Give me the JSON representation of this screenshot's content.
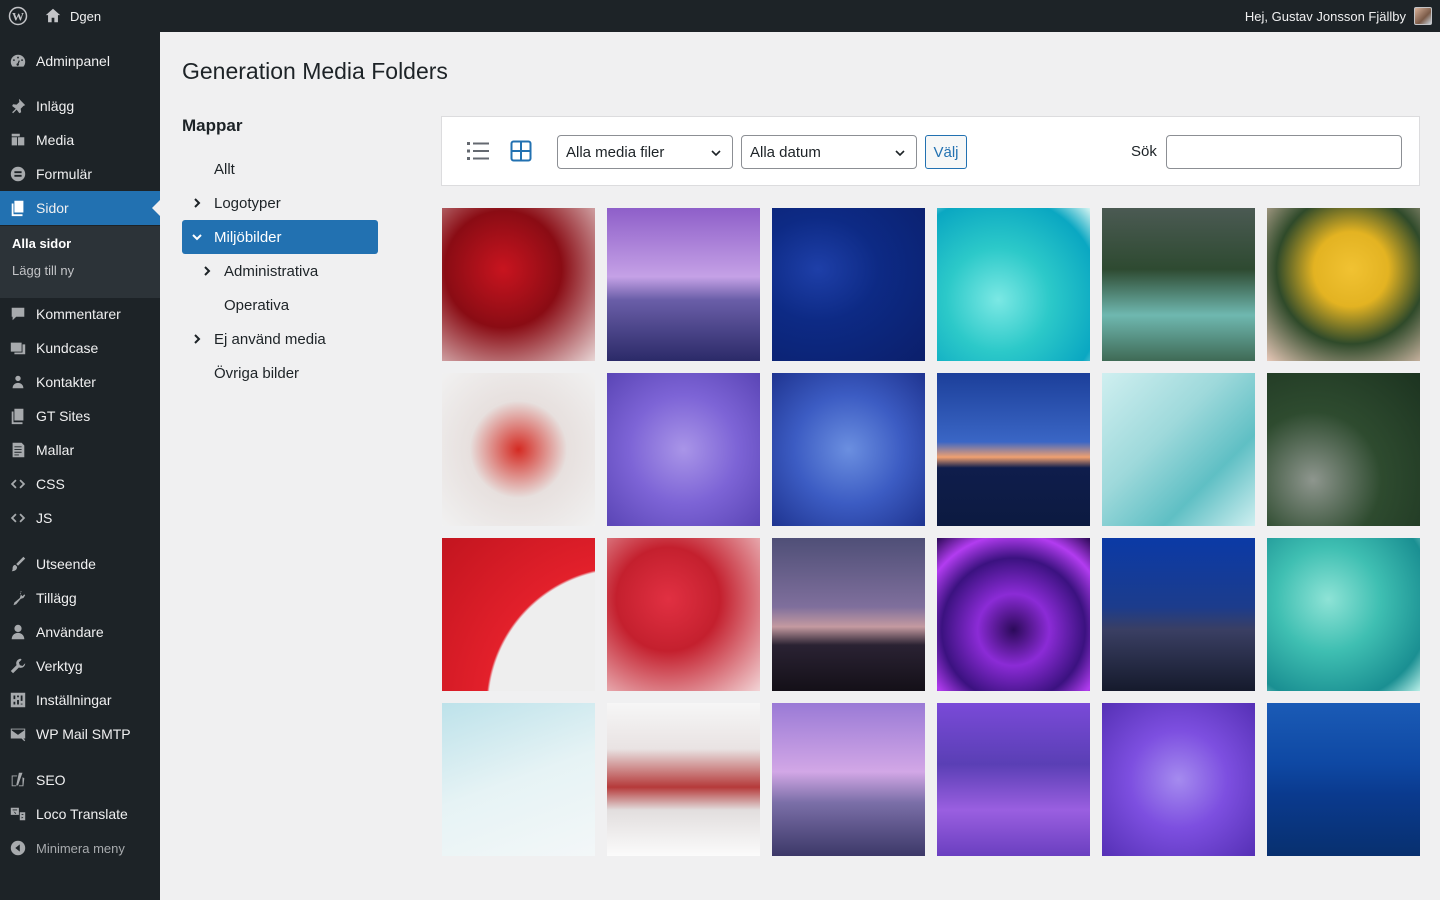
{
  "adminbar": {
    "site_name": "Dgen",
    "greeting": "Hej, Gustav Jonsson Fjällby"
  },
  "sidebar": {
    "items": [
      {
        "label": "Adminpanel",
        "icon": "dashboard-icon"
      },
      {
        "label": "Inlägg",
        "icon": "pin-icon"
      },
      {
        "label": "Media",
        "icon": "media-icon"
      },
      {
        "label": "Formulär",
        "icon": "form-icon"
      },
      {
        "label": "Sidor",
        "icon": "pages-icon"
      },
      {
        "label": "Kommentarer",
        "icon": "comment-icon"
      },
      {
        "label": "Kundcase",
        "icon": "images-icon"
      },
      {
        "label": "Kontakter",
        "icon": "contacts-icon"
      },
      {
        "label": "GT Sites",
        "icon": "pages-icon"
      },
      {
        "label": "Mallar",
        "icon": "templates-icon"
      },
      {
        "label": "CSS",
        "icon": "code-icon"
      },
      {
        "label": "JS",
        "icon": "code-icon"
      },
      {
        "label": "Utseende",
        "icon": "brush-icon"
      },
      {
        "label": "Tillägg",
        "icon": "plugin-icon"
      },
      {
        "label": "Användare",
        "icon": "user-icon"
      },
      {
        "label": "Verktyg",
        "icon": "wrench-icon"
      },
      {
        "label": "Inställningar",
        "icon": "settings-icon"
      },
      {
        "label": "WP Mail SMTP",
        "icon": "mail-icon"
      },
      {
        "label": "SEO",
        "icon": "yoast-icon"
      },
      {
        "label": "Loco Translate",
        "icon": "translate-icon"
      }
    ],
    "submenu": {
      "current": "Alla sidor",
      "other": "Lägg till ny"
    },
    "collapse": "Minimera meny"
  },
  "main": {
    "title": "Generation Media Folders",
    "folders_title": "Mappar",
    "folders": [
      {
        "label": "Allt"
      },
      {
        "label": "Logotyper"
      },
      {
        "label": "Miljöbilder"
      },
      {
        "label": "Administrativa"
      },
      {
        "label": "Operativa"
      },
      {
        "label": "Ej använd media"
      },
      {
        "label": "Övriga bilder"
      }
    ],
    "toolbar": {
      "filter_media": "Alla media filer",
      "filter_date": "Alla datum",
      "select_button": "Välj",
      "search_label": "Sök",
      "search_value": ""
    }
  },
  "colors": {
    "accent": "#2271b1",
    "sidebar_bg": "#1d2327",
    "submenu_bg": "#2c3338"
  }
}
